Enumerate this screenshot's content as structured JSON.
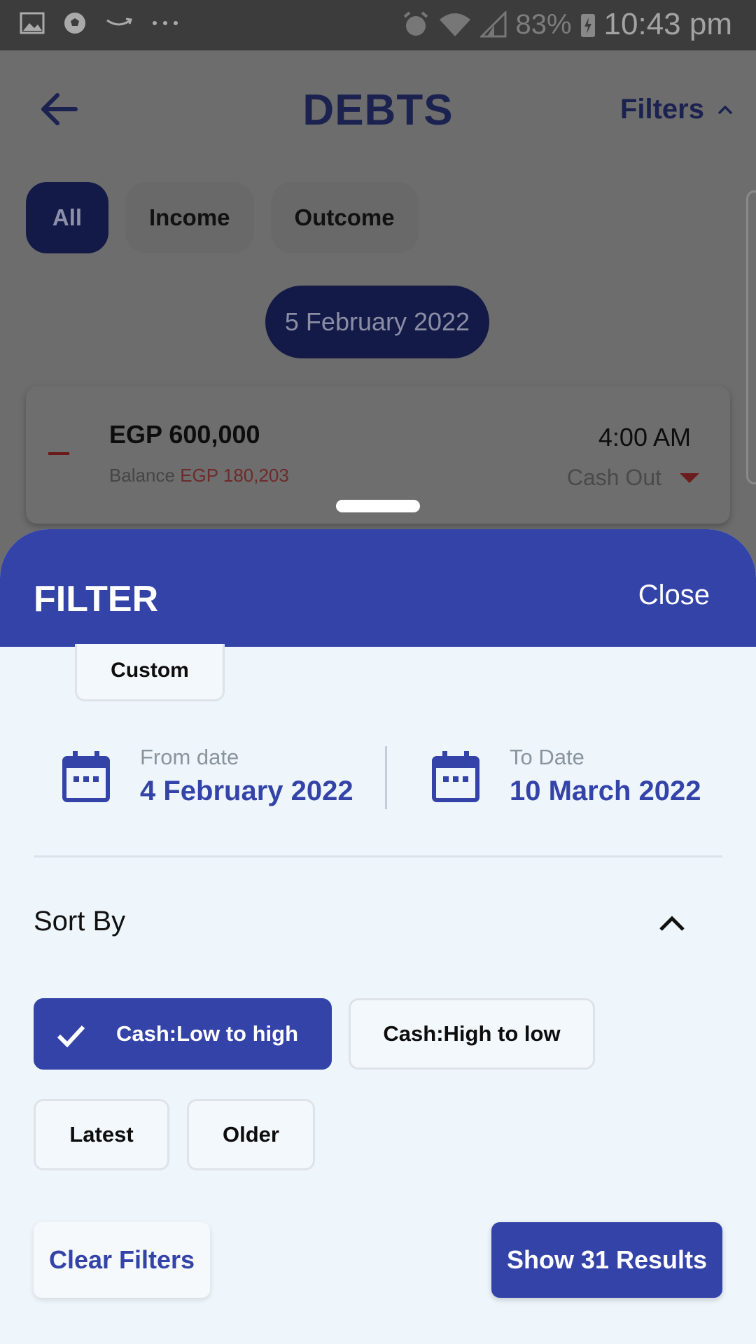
{
  "status_bar": {
    "left_icons": [
      "image-icon",
      "soccer-ball-icon",
      "amazon-smile-icon",
      "more-dots-icon"
    ],
    "battery_percent": "83%",
    "time": "10:43 pm"
  },
  "header": {
    "title": "DEBTS",
    "filters_label": "Filters"
  },
  "tabs": [
    {
      "label": "All",
      "active": true
    },
    {
      "label": "Income",
      "active": false
    },
    {
      "label": "Outcome",
      "active": false
    }
  ],
  "date_group": "5 February 2022",
  "transaction": {
    "amount": "EGP 600,000",
    "balance_label": "Balance",
    "balance_value": "EGP 180,203",
    "time": "4:00 AM",
    "type": "Cash Out"
  },
  "filter_sheet": {
    "title": "FILTER",
    "close_label": "Close",
    "period_chip": "Custom",
    "from_label": "From date",
    "from_value": "4 February 2022",
    "to_label": "To Date",
    "to_value": "10 March 2022",
    "sort_label": "Sort By",
    "sort_options": [
      {
        "label": "Cash:Low to high",
        "selected": true
      },
      {
        "label": "Cash:High to low",
        "selected": false
      },
      {
        "label": "Latest",
        "selected": false
      },
      {
        "label": "Older",
        "selected": false
      }
    ],
    "clear_label": "Clear Filters",
    "results_label": "Show 31 Results"
  },
  "colors": {
    "primary": "#3443a8",
    "dark_navy": "#131a47",
    "sheet_bg": "#eef6fc",
    "negative": "#b03030"
  }
}
